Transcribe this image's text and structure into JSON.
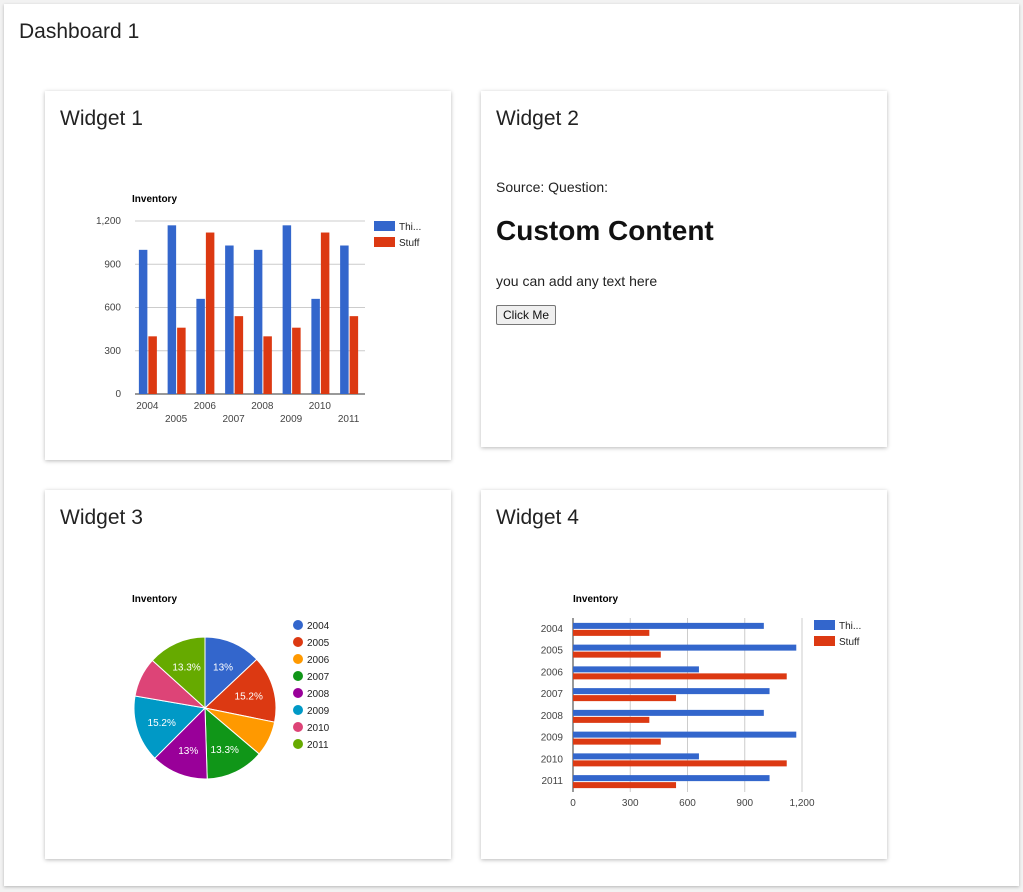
{
  "dashboard": {
    "title": "Dashboard 1"
  },
  "colors": {
    "series1": "#3366cc",
    "series2": "#dc3912",
    "pie": [
      "#3366cc",
      "#dc3912",
      "#ff9900",
      "#109618",
      "#990099",
      "#0099c6",
      "#dd4477",
      "#66aa00"
    ]
  },
  "widget1": {
    "title": "Widget 1"
  },
  "widget2": {
    "title": "Widget 2",
    "source": "Source: Question:",
    "heading": "Custom Content",
    "text": "you can add any text here",
    "button_label": "Click Me"
  },
  "widget3": {
    "title": "Widget 3"
  },
  "widget4": {
    "title": "Widget 4"
  },
  "chart_data": [
    {
      "type": "bar",
      "title": "Inventory",
      "categories": [
        "2004",
        "2005",
        "2006",
        "2007",
        "2008",
        "2009",
        "2010",
        "2011"
      ],
      "series": [
        {
          "name": "Thi...",
          "values": [
            1000,
            1170,
            660,
            1030,
            1000,
            1170,
            660,
            1030
          ]
        },
        {
          "name": "Stuff",
          "values": [
            400,
            460,
            1120,
            540,
            400,
            460,
            1120,
            540
          ]
        }
      ],
      "ylim": [
        0,
        1200
      ],
      "yticks": [
        "0",
        "300",
        "600",
        "900",
        "1,200"
      ],
      "grid": true,
      "legend": "right"
    },
    {
      "type": "pie",
      "title": "Inventory",
      "labels": [
        "2004",
        "2005",
        "2006",
        "2007",
        "2008",
        "2009",
        "2010",
        "2011"
      ],
      "values": [
        13.0,
        15.2,
        8.0,
        13.3,
        13.0,
        15.2,
        9.0,
        13.3
      ],
      "slice_labels": [
        "13%",
        "15.2%",
        "",
        "13.3%",
        "13%",
        "15.2%",
        "",
        "13.3%"
      ],
      "legend": "right"
    },
    {
      "type": "bar",
      "orientation": "horizontal",
      "title": "Inventory",
      "categories": [
        "2004",
        "2005",
        "2006",
        "2007",
        "2008",
        "2009",
        "2010",
        "2011"
      ],
      "series": [
        {
          "name": "Thi...",
          "values": [
            1000,
            1170,
            660,
            1030,
            1000,
            1170,
            660,
            1030
          ]
        },
        {
          "name": "Stuff",
          "values": [
            400,
            460,
            1120,
            540,
            400,
            460,
            1120,
            540
          ]
        }
      ],
      "xlim": [
        0,
        1200
      ],
      "xticks": [
        "0",
        "300",
        "600",
        "900",
        "1,200"
      ],
      "grid": true,
      "legend": "right"
    }
  ]
}
